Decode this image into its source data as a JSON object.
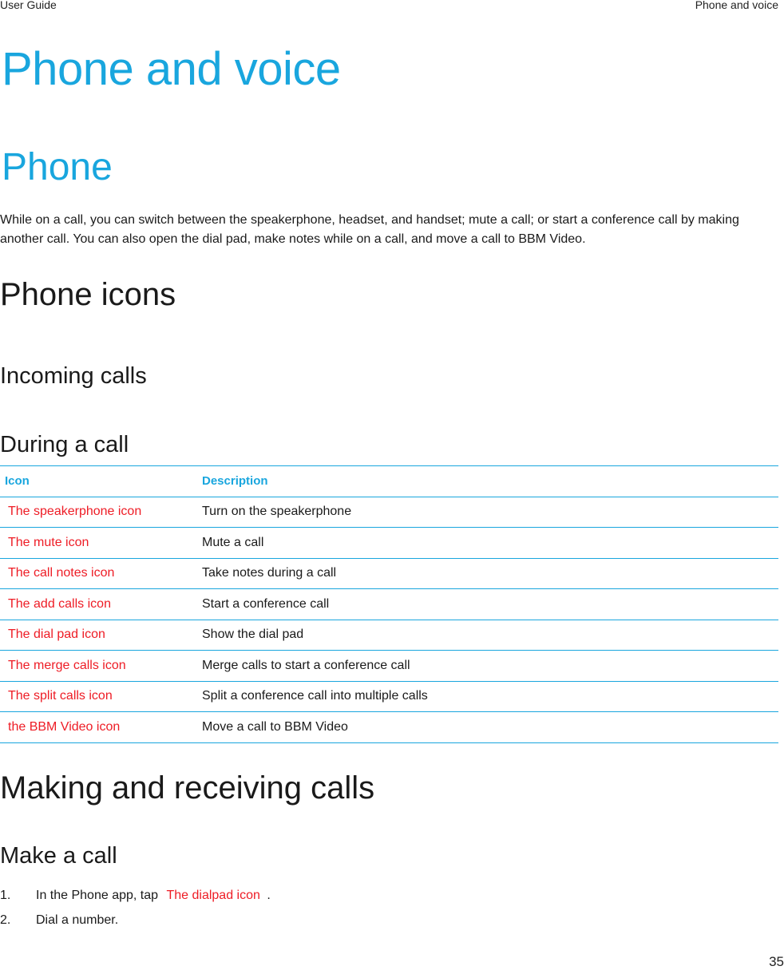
{
  "running_header": {
    "left": "User Guide",
    "right": "Phone and voice"
  },
  "chapter_title": "Phone and voice",
  "section_title": "Phone",
  "intro_text": "While on a call, you can switch between the speakerphone, headset, and handset; mute a call; or start a conference call by making another call. You can also open the dial pad, make notes while on a call, and move a call to BBM Video.",
  "headings": {
    "phone_icons": "Phone icons",
    "incoming_calls": "Incoming calls",
    "during_a_call": "During a call",
    "making_receiving": "Making and receiving calls",
    "make_a_call": "Make a call"
  },
  "icon_table": {
    "headers": [
      "Icon",
      "Description"
    ],
    "rows": [
      {
        "icon": "The speakerphone icon",
        "description": "Turn on the speakerphone"
      },
      {
        "icon": "The mute icon",
        "description": "Mute a call"
      },
      {
        "icon": "The call notes icon",
        "description": "Take notes during a call"
      },
      {
        "icon": "The add calls icon",
        "description": "Start a conference call"
      },
      {
        "icon": "The dial pad icon",
        "description": "Show the dial pad"
      },
      {
        "icon": "The merge calls icon",
        "description": "Merge calls to start a conference call"
      },
      {
        "icon": "The split calls icon",
        "description": "Split a conference call into multiple calls"
      },
      {
        "icon": "the BBM Video icon",
        "description": "Move a call to BBM Video"
      }
    ]
  },
  "make_call_steps": [
    {
      "number": "1.",
      "text_before": "In the Phone app, tap",
      "icon_alt": "The dialpad icon",
      "text_after": "."
    },
    {
      "number": "2.",
      "text_before": "Dial a number.",
      "icon_alt": null,
      "text_after": null
    }
  ],
  "page_number": "35",
  "colors": {
    "accent_blue": "#19a6de",
    "missing_icon_red": "#ee1c25",
    "body_text": "#1a1a1a"
  }
}
